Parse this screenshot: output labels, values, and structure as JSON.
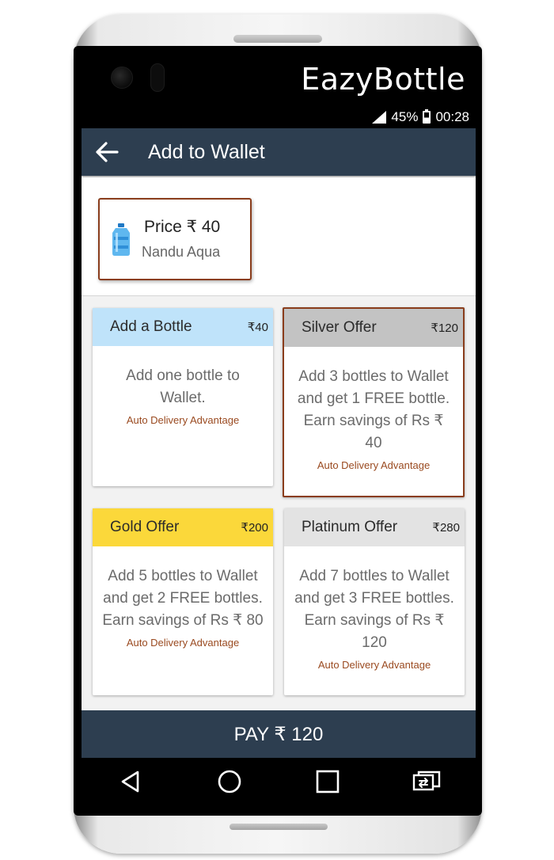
{
  "device": {
    "brand": "EazyBottle"
  },
  "status_bar": {
    "battery": "45%",
    "time": "00:28"
  },
  "appbar": {
    "title": "Add to Wallet"
  },
  "product": {
    "price_label": "Price ₹ 40",
    "name": "Nandu Aqua",
    "icon": "water-bottle-icon"
  },
  "offers": [
    {
      "title": "Add a Bottle",
      "price": "₹40",
      "description": "Add one bottle to Wallet.",
      "advantage": "Auto Delivery Advantage",
      "header_color": "#bfe3fa",
      "selected": false
    },
    {
      "title": "Silver Offer",
      "price": "₹120",
      "description": "Add 3 bottles to Wallet and get 1 FREE bottle. Earn savings of Rs ₹ 40",
      "advantage": "Auto Delivery Advantage",
      "header_color": "#c3c3c3",
      "selected": true
    },
    {
      "title": "Gold Offer",
      "price": "₹200",
      "description": "Add 5 bottles to Wallet and get 2 FREE bottles. Earn savings of Rs ₹ 80",
      "advantage": "Auto Delivery Advantage",
      "header_color": "#fbd83a",
      "selected": false
    },
    {
      "title": "Platinum Offer",
      "price": "₹280",
      "description": "Add 7 bottles to Wallet and get 3 FREE bottles. Earn savings of Rs ₹ 120",
      "advantage": "Auto Delivery Advantage",
      "header_color": "#e3e3e3",
      "selected": false
    }
  ],
  "pay_button": {
    "label": "PAY ₹ 120"
  },
  "nav": {
    "back_icon": "back-triangle-icon",
    "home_icon": "home-circle-icon",
    "recents_icon": "recents-square-icon",
    "switch_icon": "switch-app-icon"
  },
  "colors": {
    "appbar": "#2d3e50",
    "accent_border": "#8a3d1c",
    "advantage_text": "#9a4a20"
  }
}
